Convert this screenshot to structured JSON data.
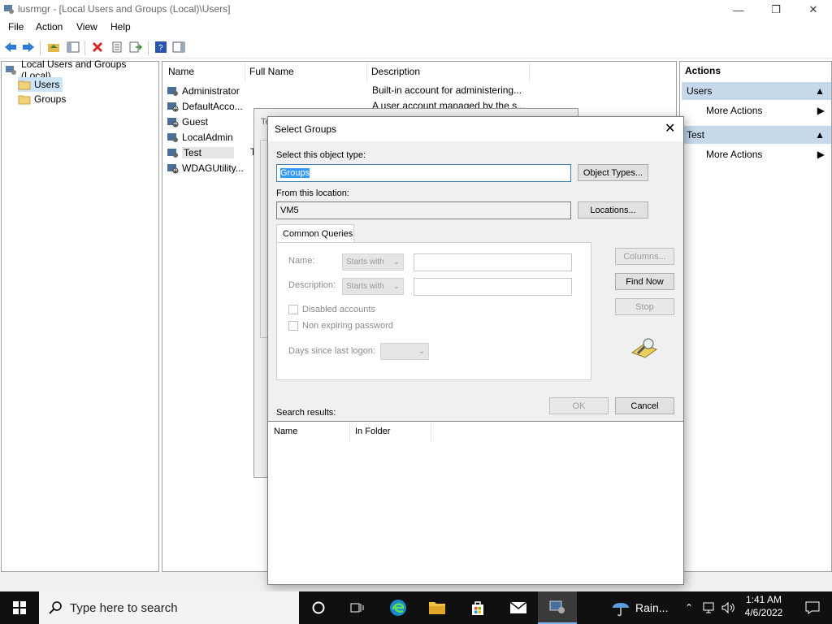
{
  "window": {
    "title": "lusrmgr - [Local Users and Groups (Local)\\Users]"
  },
  "menu": [
    "File",
    "Action",
    "View",
    "Help"
  ],
  "tree": {
    "root": "Local Users and Groups (Local)",
    "items": [
      "Users",
      "Groups"
    ]
  },
  "list": {
    "columns": {
      "name": "Name",
      "full_name": "Full Name",
      "description": "Description"
    },
    "rows": [
      {
        "name": "Administrator",
        "full_name": "",
        "description": "Built-in account for administering..."
      },
      {
        "name": "DefaultAcco...",
        "full_name": "",
        "description": "A user account managed by the s..."
      },
      {
        "name": "Guest",
        "full_name": "",
        "description": ""
      },
      {
        "name": "LocalAdmin",
        "full_name": "",
        "description": ""
      },
      {
        "name": "Test",
        "full_name": "T",
        "description": ""
      },
      {
        "name": "WDAGUtility...",
        "full_name": "",
        "description": ""
      }
    ]
  },
  "actions": {
    "header": "Actions",
    "sections": [
      {
        "title": "Users",
        "item": "More Actions"
      },
      {
        "title": "Test",
        "item": "More Actions"
      }
    ]
  },
  "behind_dialog": {
    "title_fragment": "Te"
  },
  "dialog": {
    "title": "Select Groups",
    "object_type_label": "Select this object type:",
    "object_type_value": "Groups",
    "object_types_button": "Object Types...",
    "location_label": "From this location:",
    "location_value": "VM5",
    "locations_button": "Locations...",
    "tab": "Common Queries",
    "name_label": "Name:",
    "description_label": "Description:",
    "starts_with": "Starts with",
    "disabled_accounts": "Disabled accounts",
    "non_expiring": "Non expiring password",
    "days_since_logon": "Days since last logon:",
    "columns_button": "Columns...",
    "find_now_button": "Find Now",
    "stop_button": "Stop",
    "ok_button": "OK",
    "cancel_button": "Cancel",
    "search_results_label": "Search results:",
    "results_columns": {
      "name": "Name",
      "in_folder": "In Folder"
    }
  },
  "taskbar": {
    "search_placeholder": "Type here to search",
    "weather": "Rain...",
    "time": "1:41 AM",
    "date": "4/6/2022"
  }
}
